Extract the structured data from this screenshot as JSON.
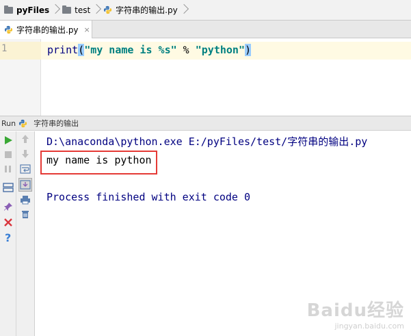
{
  "breadcrumb": {
    "items": [
      "pyFiles",
      "test",
      "字符串的输出.py"
    ]
  },
  "editor": {
    "tab_label": "字符串的输出.py",
    "tab_close": "×",
    "line_number": "1",
    "code": {
      "fn": "print",
      "open_paren": "(",
      "string1": "\"my name is %s\"",
      "op": " % ",
      "string2": "\"python\"",
      "close_paren": ")"
    }
  },
  "run": {
    "label": "Run",
    "config_name": "字符串的输出"
  },
  "console": {
    "command": "D:\\anaconda\\python.exe E:/pyFiles/test/字符串的输出.py",
    "output": "my name is python",
    "finished": "Process finished with exit code 0"
  },
  "watermark": {
    "logo": "Baidu经验",
    "sub": "jingyan.baidu.com"
  },
  "colors": {
    "run_green": "#3aa835",
    "stop_gray": "#bdbdbd",
    "close_red": "#d9363e",
    "help_blue": "#3a7fd5",
    "highlight_red": "#e53935",
    "string_teal": "#008080",
    "keyword_navy": "#000080"
  }
}
